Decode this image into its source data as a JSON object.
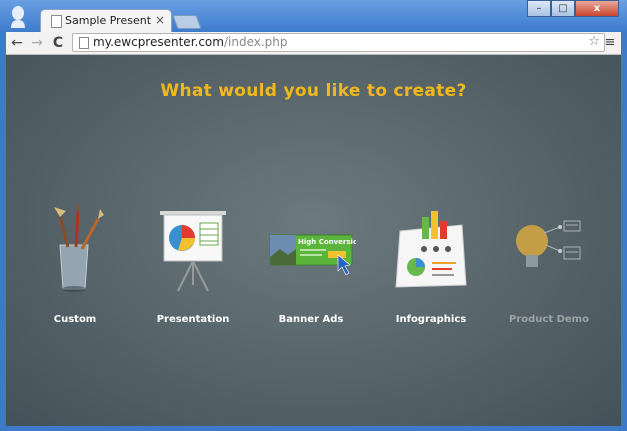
{
  "browser": {
    "tab_title": "Sample Presentation – Cre",
    "tab_close": "×",
    "url_host": "my.ewcpresenter.com",
    "url_path": "/index.php",
    "back": "←",
    "forward": "→",
    "reload": "C",
    "star": "☆",
    "menu": "≡",
    "win_min": "–",
    "win_max": "□",
    "win_close": "x"
  },
  "page": {
    "headline": "What would you like to create?",
    "options": [
      {
        "label": "Custom",
        "icon": "paintbrush-cup-icon"
      },
      {
        "label": "Presentation",
        "icon": "easel-chart-icon"
      },
      {
        "label": "Banner Ads",
        "icon": "banner-ad-icon"
      },
      {
        "label": "Infographics",
        "icon": "infographic-icon"
      },
      {
        "label": "Product Demo",
        "icon": "lightbulb-icon"
      }
    ],
    "banner_ad_text": "High Conversion"
  },
  "colors": {
    "headline": "#f1b81c",
    "background": "#566369",
    "frame": "#3f79c9"
  }
}
